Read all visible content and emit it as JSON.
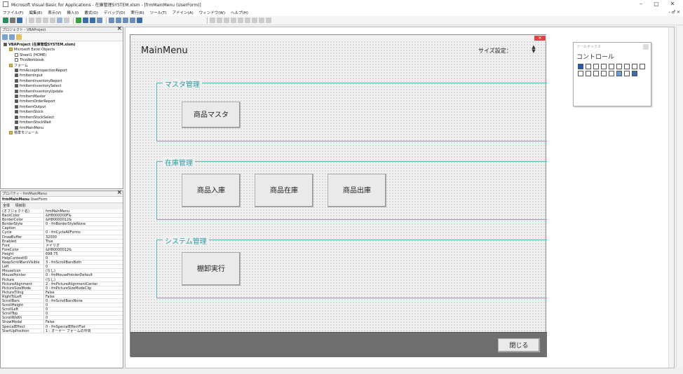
{
  "window": {
    "title": "Microsoft Visual Basic for Applications - 在庫管理SYSTEM.xlsm - [frmMainMenu (UserForm)]",
    "min": "–",
    "max": "▢",
    "close": "✕",
    "close2": "- ♂ ×"
  },
  "menu": [
    "ファイル(F)",
    "編集(E)",
    "表示(V)",
    "挿入(I)",
    "書式(O)",
    "デバッグ(D)",
    "実行(R)",
    "ツール(T)",
    "アドイン(A)",
    "ウィンドウ(W)",
    "ヘルプ(H)"
  ],
  "project": {
    "title": "プロジェクト - VBAProject",
    "close": "×",
    "items": [
      "VBAProject (在庫管理SYSTEM.xlsm)",
      "Microsoft Excel Objects",
      "Sheet1 (HOME)",
      "ThisWorkbook",
      "フォーム",
      "frmAcceptInspectionReport",
      "frmItemInput",
      "frmItemInventoryReport",
      "frmItemInventorySelect",
      "frmItemInventoryUpdate",
      "frmItemMaster",
      "frmItemOrderReport",
      "frmItemOutput",
      "frmItemStock",
      "frmItemStockSelect",
      "frmItemStockWait",
      "frmMainMenu",
      "標準モジュール"
    ]
  },
  "properties": {
    "title": "プロパティ - frmMainMenu",
    "close": "×",
    "object": "frmMainMenu",
    "object_type": "UserForm",
    "tab_all": "全体",
    "tab_cat": "項目別",
    "rows": [
      [
        "(オブジェクト名)",
        "frmMainMenu"
      ],
      [
        "BackColor",
        "&H8000000F&"
      ],
      [
        "BorderColor",
        "&H80000012&"
      ],
      [
        "BorderStyle",
        "0 - fmBorderStyleNone"
      ],
      [
        "Caption",
        ""
      ],
      [
        "Cycle",
        "0 - fmCycleAllForms"
      ],
      [
        "DrawBuffer",
        "32000"
      ],
      [
        "Enabled",
        "True"
      ],
      [
        "Font",
        "メイリオ"
      ],
      [
        "ForeColor",
        "&H80000012&"
      ],
      [
        "Height",
        "698.75"
      ],
      [
        "HelpContextID",
        "0"
      ],
      [
        "KeepScrollBarsVisible",
        "3 - fmScrollBarsBoth"
      ],
      [
        "Left",
        "0"
      ],
      [
        "MouseIcon",
        "(なし)"
      ],
      [
        "MousePointer",
        "0 - fmMousePointerDefault"
      ],
      [
        "Picture",
        "(なし)"
      ],
      [
        "PictureAlignment",
        "2 - fmPictureAlignmentCenter"
      ],
      [
        "PictureSizeMode",
        "0 - fmPictureSizeModeClip"
      ],
      [
        "PictureTiling",
        "False"
      ],
      [
        "RightToLeft",
        "False"
      ],
      [
        "ScrollBars",
        "0 - fmScrollBarsNone"
      ],
      [
        "ScrollHeight",
        "0"
      ],
      [
        "ScrollLeft",
        "0"
      ],
      [
        "ScrollTop",
        "0"
      ],
      [
        "ScrollWidth",
        "0"
      ],
      [
        "ShowModal",
        "False"
      ],
      [
        "SpecialEffect",
        "0 - fmSpecialEffectFlat"
      ],
      [
        "StartUpPosition",
        "1 - オーナー フォームの中央"
      ]
    ]
  },
  "form": {
    "title": "MainMenu",
    "size_label": "サイズ設定：",
    "spin": "▲\n▼",
    "frame_master": "マスタ管理",
    "btn_item_master": "商品マスタ",
    "frame_stock": "在庫管理",
    "btn_in": "商品入庫",
    "btn_stock": "商品在庫",
    "btn_out": "商品出庫",
    "frame_system": "システム管理",
    "btn_inventory": "棚卸実行",
    "btn_close": "閉じる",
    "close_x": "✕"
  },
  "toolbox": {
    "title": "ツールボックス",
    "tab": "コントロール"
  }
}
